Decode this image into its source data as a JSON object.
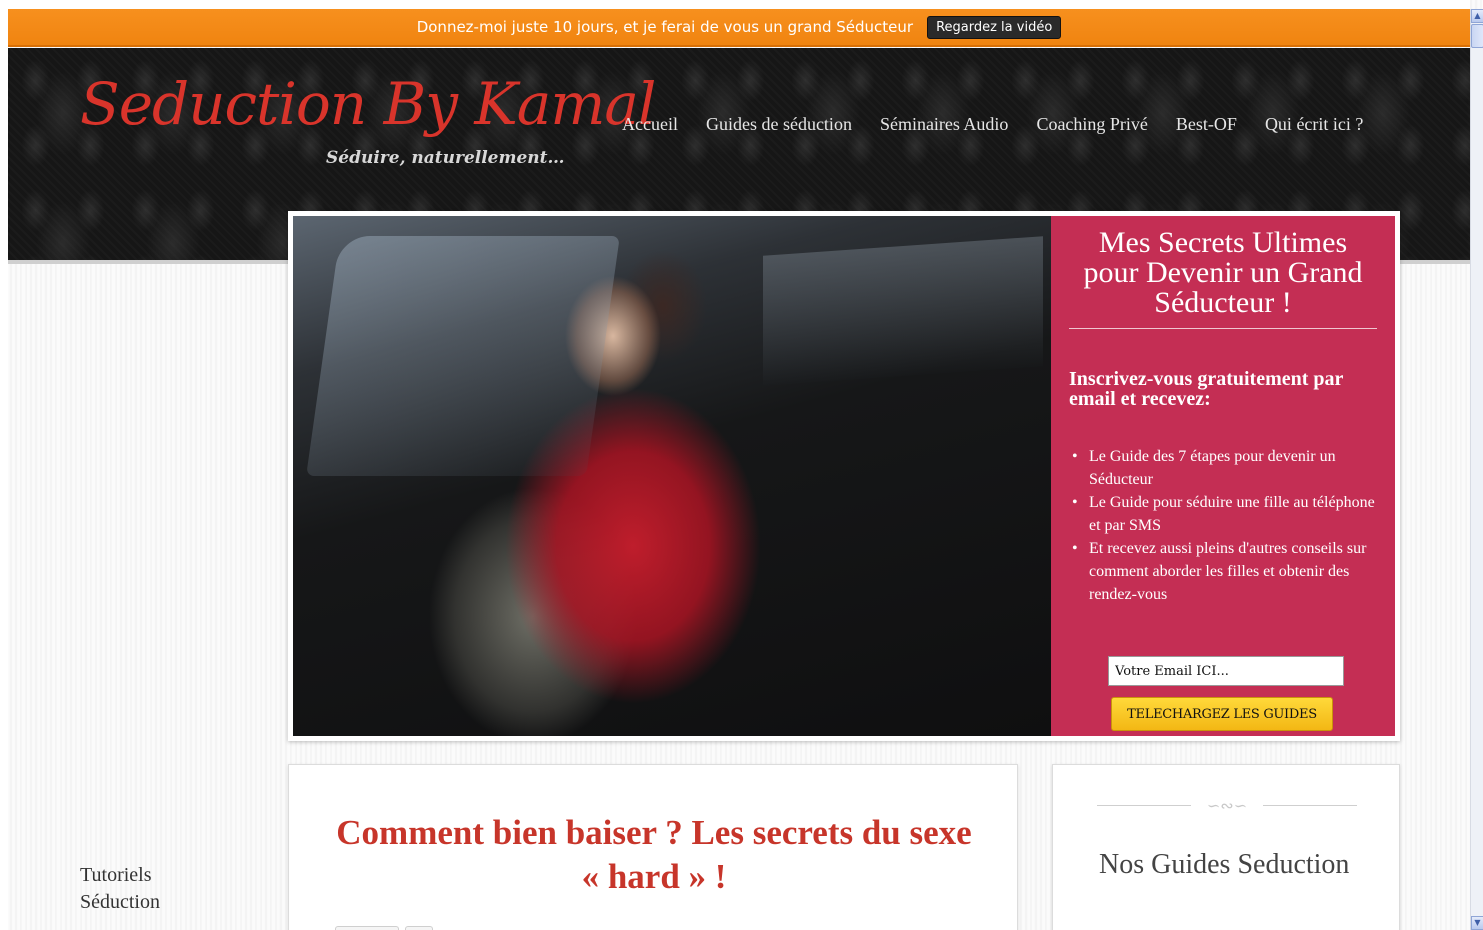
{
  "promo": {
    "text": "Donnez-moi juste 10 jours, et je ferai de vous un grand Séducteur",
    "button_label": "Regardez la vidéo"
  },
  "header": {
    "logo_title": "Seduction By Kamal",
    "tagline": "Séduire, naturellement…",
    "nav": [
      {
        "label": "Accueil"
      },
      {
        "label": "Guides de séduction"
      },
      {
        "label": "Séminaires Audio"
      },
      {
        "label": "Coaching Privé"
      },
      {
        "label": "Best-OF"
      },
      {
        "label": "Qui écrit ici ?"
      }
    ]
  },
  "hero": {
    "panel_title": "Mes Secrets Ultimes pour Devenir un Grand Séducteur !",
    "panel_subtitle": "Inscrivez-vous gratuitement par email et recevez:",
    "benefits": [
      "Le Guide des 7 étapes pour devenir un Séducteur",
      "Le Guide pour séduire une fille au téléphone et par SMS",
      "Et recevez aussi pleins d'autres conseils sur comment aborder les filles et obtenir des rendez-vous"
    ],
    "email_placeholder": "Votre Email ICI...",
    "cta_label": "TELECHARGEZ LES GUIDES"
  },
  "sidebar": {
    "label_line1": "Tutoriels",
    "label_line2": "Séduction"
  },
  "article": {
    "title": "Comment bien baiser ? Les secrets du sexe « hard » !"
  },
  "widget": {
    "title": "Nos Guides Seduction"
  },
  "scrollbar": {
    "up_icon": "▲",
    "down_icon": "▼"
  }
}
